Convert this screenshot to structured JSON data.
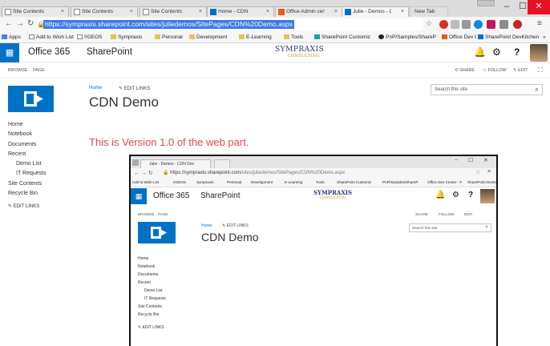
{
  "browser": {
    "tabs": [
      {
        "label": "Site Contents"
      },
      {
        "label": "Site Contents"
      },
      {
        "label": "Site Contents"
      },
      {
        "label": "Home - CDN"
      },
      {
        "label": "Office Admin center -"
      },
      {
        "label": "Julie - Demos - CDN"
      },
      {
        "label": "New Tab"
      }
    ],
    "url": "https://sympraxis.sharepoint.com/sites/juliedemos/SitePages/CDN%20Demo.aspx",
    "bookmarks": [
      {
        "label": "Apps"
      },
      {
        "label": "Add to Wish List"
      },
      {
        "label": "!!GEOS"
      },
      {
        "label": "Sympraxis"
      },
      {
        "label": "Personal"
      },
      {
        "label": "Development"
      },
      {
        "label": "E-Learning"
      },
      {
        "label": "Tools"
      },
      {
        "label": "SharePoint Customiz"
      },
      {
        "label": "PnP/Samples/ShareP"
      },
      {
        "label": "Office Dev Center - F"
      },
      {
        "label": "SharePoint DevKitchen"
      }
    ],
    "more_bookmarks": "»"
  },
  "suite": {
    "office365": "Office 365",
    "sharepoint": "SharePoint",
    "logo_main": "SYMPRAXIS",
    "logo_sub": "CONSULTING"
  },
  "ribbon": {
    "browse": "BROWSE",
    "page": "PAGE",
    "share": "SHARE",
    "follow": "FOLLOW",
    "edit": "EDIT"
  },
  "page": {
    "breadcrumb_home": "Home",
    "edit_links": "EDIT LINKS",
    "title": "CDN Demo",
    "search_placeholder": "Search this site",
    "webpart_text": "This is Version 1.0 of the web part."
  },
  "leftnav": {
    "items": [
      "Home",
      "Notebook",
      "Documents",
      "Recent",
      "Demo List",
      "IT Requests",
      "Site Contents",
      "Recycle Bin"
    ],
    "edit_links": "EDIT LINKS"
  },
  "inner": {
    "tab": "Julie - Demos - CDN Dev",
    "url_host": "https://sympraxis.sharepoint.com",
    "url_path": "/sites/juliedemos/SitePages/CDN%20Demo.aspx",
    "bookmarks": [
      {
        "label": "Add to Wish List"
      },
      {
        "label": "!!GEOS"
      },
      {
        "label": "Sympraxis"
      },
      {
        "label": "Personal"
      },
      {
        "label": "Development"
      },
      {
        "label": "E-Learning"
      },
      {
        "label": "Tools"
      },
      {
        "label": "SharePoint Customiz"
      },
      {
        "label": "PnP/Samples/ShareP"
      },
      {
        "label": "Office Dev Center - F"
      },
      {
        "label": "SharePoint DevKitchen"
      }
    ]
  },
  "colors": {
    "accent": "#0072c6",
    "webpart_red": "#e8474c",
    "close_red": "#e81123",
    "url_select": "#3b78e7"
  }
}
